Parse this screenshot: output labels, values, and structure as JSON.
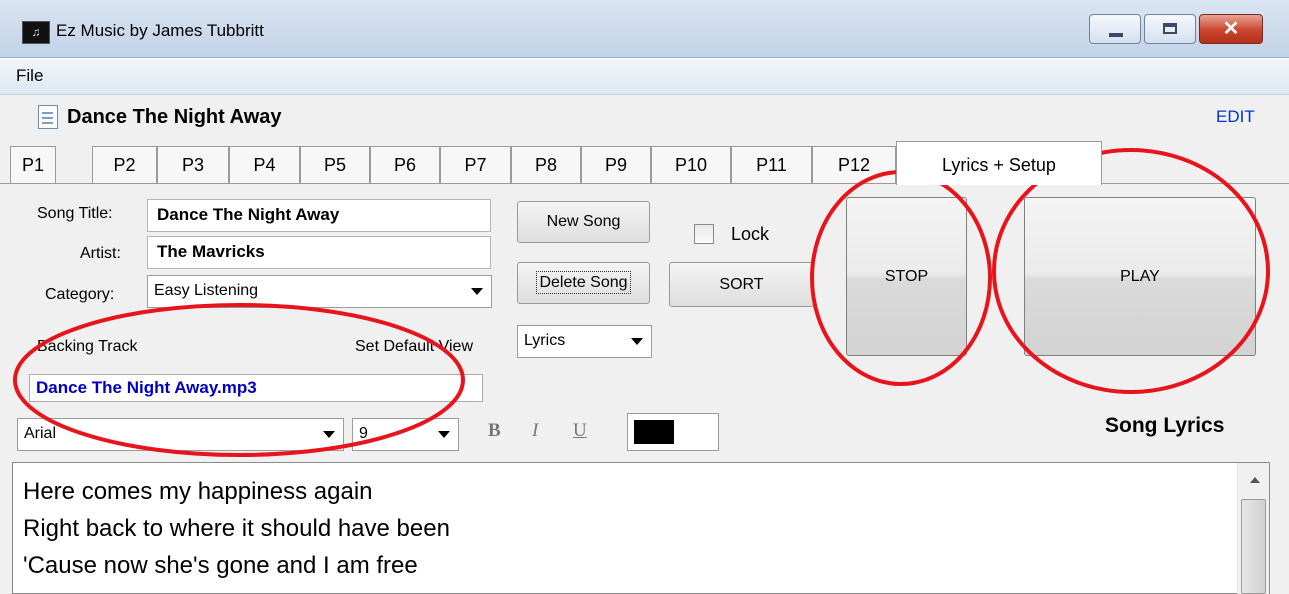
{
  "window": {
    "title": "Ez Music by James Tubbritt",
    "close_glyph": "✕"
  },
  "menu": {
    "file": "File"
  },
  "song_header": {
    "title": "Dance The Night Away",
    "edit_label": "EDIT"
  },
  "tabs": [
    "P1",
    "P2",
    "P3",
    "P4",
    "P5",
    "P6",
    "P7",
    "P8",
    "P9",
    "P10",
    "P11",
    "P12",
    "Lyrics + Setup"
  ],
  "active_tab": "Lyrics + Setup",
  "form": {
    "song_title_label": "Song Title:",
    "song_title_value": "Dance The Night Away",
    "artist_label": "Artist:",
    "artist_value": "The Mavricks",
    "category_label": "Category:",
    "category_value": "Easy Listening",
    "backing_track_label": "Backing Track",
    "set_default_view_label": "Set Default View",
    "default_view_value": "Lyrics",
    "backing_track_value": "Dance The Night Away.mp3"
  },
  "buttons": {
    "new_song": "New Song",
    "delete_song": "Delete Song",
    "lock_label": "Lock",
    "sort": "SORT",
    "stop": "STOP",
    "play": "PLAY"
  },
  "formatting": {
    "font_name": "Arial",
    "font_size": "9",
    "bold": "B",
    "italic": "I",
    "underline": "U",
    "text_color": "#000000"
  },
  "lyrics": {
    "heading": "Song Lyrics",
    "lines": [
      "Here comes my happiness again",
      "Right back to where it should have been",
      "'Cause now she's gone and I am free"
    ]
  },
  "colors": {
    "annotation": "#e8141b",
    "link": "#0033cc",
    "backing_track_text": "#0000c0"
  },
  "icons": [
    "app-icon",
    "document-icon",
    "minimize-icon",
    "maximize-icon",
    "close-icon",
    "dropdown-arrow-icon",
    "scroll-up-arrow-icon"
  ]
}
